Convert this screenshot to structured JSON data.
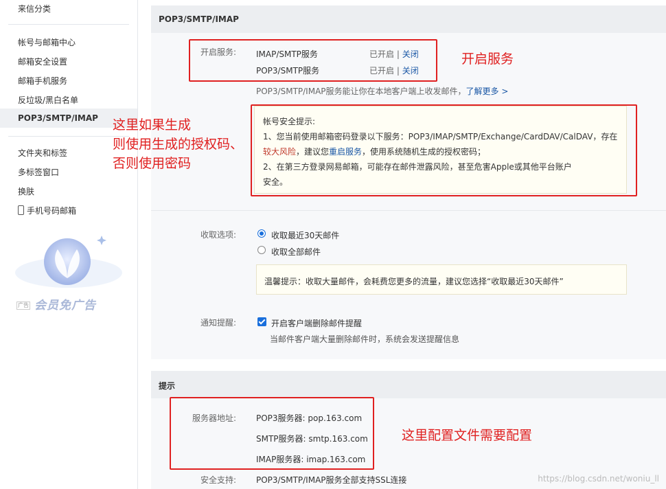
{
  "sidebar": {
    "top_item": "来信分类",
    "items": [
      "帐号与邮箱中心",
      "邮箱安全设置",
      "邮箱手机服务",
      "反垃圾/黑白名单",
      "POP3/SMTP/IMAP",
      "文件夹和标签",
      "多标签窗口",
      "换肤",
      "手机号码邮箱"
    ],
    "promo_ad": "广告",
    "promo_text": "会员免广告"
  },
  "pop_panel": {
    "title": "POP3/SMTP/IMAP",
    "enable_label": "开启服务:",
    "services": [
      {
        "name": "IMAP/SMTP服务",
        "status": "已开启",
        "sep": "|",
        "action": "关闭"
      },
      {
        "name": "POP3/SMTP服务",
        "status": "已开启",
        "sep": "|",
        "action": "关闭"
      }
    ],
    "desc": "POP3/SMTP/IMAP服务能让你在本地客户端上收发邮件，",
    "learn_more": "了解更多 >",
    "security_tip": {
      "title": "帐号安全提示:",
      "line1": "1、您当前使用邮箱密码登录以下服务：POP3/IMAP/SMTP/Exchange/CardDAV/CalDAV，存在",
      "line2_red": "较大风险",
      "line2_mid": "，建议您",
      "line2_link": "重启服务",
      "line2_end": "，使用系统随机生成的授权密码；",
      "line3": "2、在第三方登录网易邮箱，可能存在邮件泄露风险，甚至危害Apple或其他平台账户",
      "line4": "安全。"
    },
    "receive_label": "收取选项:",
    "receive_options": [
      "收取最近30天邮件",
      "收取全部邮件"
    ],
    "receive_selected": "收取最近30天邮件",
    "receive_tip": "温馨提示：收取大量邮件，会耗费您更多的流量，建议您选择“收取最近30天邮件”",
    "notify_label": "通知提醒:",
    "notify_checkbox": "开启客户端删除邮件提醒",
    "notify_checked": true,
    "notify_desc": "当邮件客户端大量删除邮件时，系统会发送提醒信息"
  },
  "tips_panel": {
    "title": "提示",
    "server_label": "服务器地址:",
    "servers": [
      "POP3服务器: pop.163.com",
      "SMTP服务器: smtp.163.com",
      "IMAP服务器: imap.163.com"
    ],
    "ssl_label": "安全支持:",
    "ssl_text": "POP3/SMTP/IMAP服务全部支持SSL连接"
  },
  "annotations": {
    "enable_service": "开启服务",
    "auth_line1": "这里如果生成",
    "auth_line2": "则使用生成的授权码、",
    "auth_line3": "否则使用密码",
    "config": "这里配置文件需要配置"
  },
  "watermark": "https://blog.csdn.net/woniu_ll",
  "colors": {
    "annotation_red": "#e02020",
    "link_blue": "#1a57a5",
    "accent_blue": "#1a6fdc"
  }
}
